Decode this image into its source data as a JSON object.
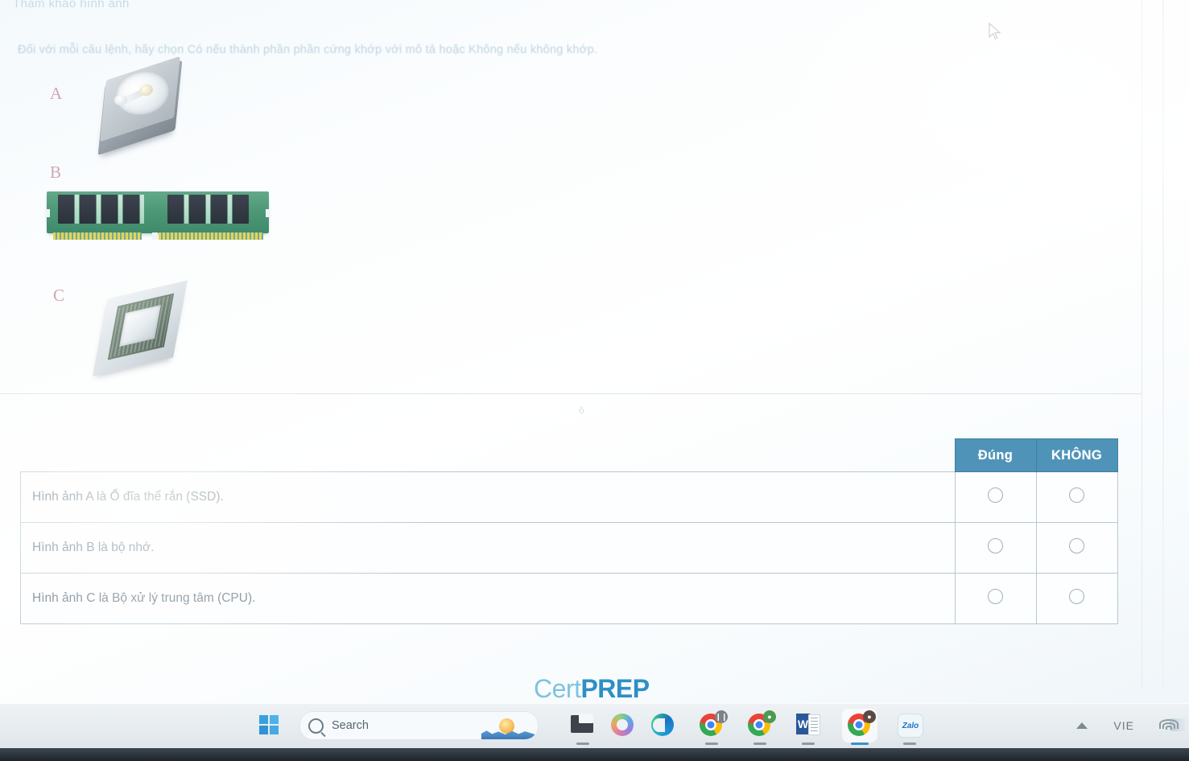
{
  "quiz": {
    "heading": "Tham khảo hình ảnh",
    "instruction": "Đối với mỗi câu lệnh, hãy chọn Có nếu thành phần phần cứng khớp với mô tả hoặc Không nếu không khớp.",
    "stray_mark": "ô",
    "images": [
      {
        "label": "A",
        "name": "hard-disk-drive-image"
      },
      {
        "label": "B",
        "name": "ram-memory-module-image"
      },
      {
        "label": "C",
        "name": "cpu-processor-image"
      }
    ],
    "table": {
      "columns": [
        "",
        "Đúng",
        "KHÔNG"
      ],
      "rows": [
        {
          "statement": "Hình ảnh A là Ổ đĩa thể rắn (SSD).",
          "dung_selected": false,
          "khong_selected": false
        },
        {
          "statement": "Hình ảnh B là bộ nhớ.",
          "dung_selected": false,
          "khong_selected": false
        },
        {
          "statement": "Hình ảnh C là Bộ xử lý trung tâm (CPU).",
          "dung_selected": false,
          "khong_selected": false
        }
      ]
    },
    "logo": {
      "prefix": "Cert",
      "suffix": "PREP"
    },
    "accent_color": "#4f94b8"
  },
  "taskbar": {
    "start": "start-button",
    "search": {
      "placeholder": "Search"
    },
    "apps": [
      {
        "name": "file-explorer-icon",
        "label": "File Explorer"
      },
      {
        "name": "copilot-icon",
        "label": "Copilot"
      },
      {
        "name": "edge-icon",
        "label": "Microsoft Edge"
      },
      {
        "name": "chrome-icon-1",
        "label": "Google Chrome"
      },
      {
        "name": "chrome-icon-2",
        "label": "Google Chrome"
      },
      {
        "name": "word-icon",
        "label": "Microsoft Word"
      },
      {
        "name": "chrome-icon-3",
        "label": "Google Chrome"
      },
      {
        "name": "zalo-icon",
        "label": "Zalo"
      }
    ],
    "tray": {
      "overflow": "show-hidden-icons",
      "language": "VIE",
      "network": "wifi-icon"
    }
  }
}
